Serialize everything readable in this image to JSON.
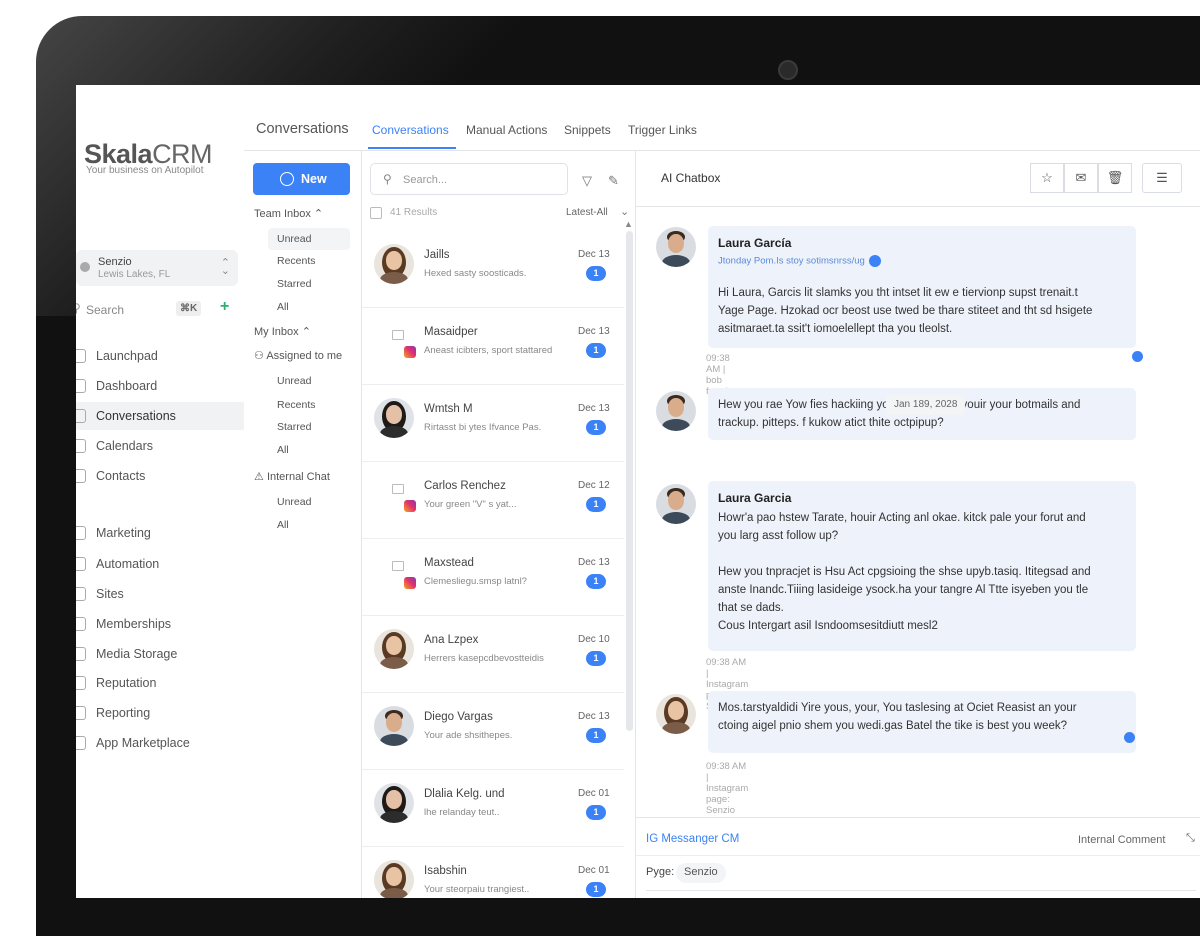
{
  "brand": {
    "name_bold": "Skala",
    "name_light": "CRM",
    "tagline": "Your business on Autopilot"
  },
  "location": {
    "name": "Senzio",
    "address": "Lewis Lakes, FL"
  },
  "nav_search": {
    "placeholder": "Search",
    "shortcut": "⌘K"
  },
  "nav": [
    {
      "label": "Launchpad"
    },
    {
      "label": "Dashboard"
    },
    {
      "label": "Conversations"
    },
    {
      "label": "Calendars"
    },
    {
      "label": "Contacts"
    },
    {
      "label": "Marketing"
    },
    {
      "label": "Automation"
    },
    {
      "label": "Sites"
    },
    {
      "label": "Memberships"
    },
    {
      "label": "Media Storage"
    },
    {
      "label": "Reputation"
    },
    {
      "label": "Reporting"
    },
    {
      "label": "App Marketplace"
    }
  ],
  "topbar": {
    "title": "Conversations",
    "tabs": [
      {
        "label": "Conversations"
      },
      {
        "label": "Manual Actions"
      },
      {
        "label": "Snippets"
      },
      {
        "label": "Trigger Links"
      }
    ]
  },
  "filters": {
    "new_label": "New",
    "team_inbox": "Team Inbox",
    "team_items": [
      "Unread",
      "Recents",
      "Starred",
      "All"
    ],
    "my_inbox": "My Inbox",
    "assigned": "Assigned to me",
    "my_items": [
      "Unread",
      "Recents",
      "Starred",
      "All"
    ],
    "internal_chat": "Internal Chat",
    "chat_items": [
      "Unread",
      "All"
    ]
  },
  "list": {
    "search_placeholder": "Search...",
    "results": "41 Results",
    "sort": "Latest-All",
    "rows": [
      {
        "name": "Jaills",
        "preview": "Hexed sasty soosticads.",
        "date": "Dec 13",
        "count": "1",
        "avatar": "woman-brown"
      },
      {
        "name": "Masaidper",
        "preview": "Aneast icibters, sport stattared",
        "date": "Dec 13",
        "count": "1",
        "avatar": "ig"
      },
      {
        "name": "Wmtsh M",
        "preview": "Rirtasst bi ytes Ifvance Pas.",
        "date": "Dec 13",
        "count": "1",
        "avatar": "woman-dark"
      },
      {
        "name": "Carlos Renchez",
        "preview": "Your green \"V\" s yat...",
        "date": "Dec 12",
        "count": "1",
        "avatar": "ig"
      },
      {
        "name": "Maxstead",
        "preview": "Clemesliegu.smsp latnl?",
        "date": "Dec 13",
        "count": "1",
        "avatar": "ig"
      },
      {
        "name": "Ana Lzpex",
        "preview": "Herrers kasepcdbevostteidis",
        "date": "Dec 10",
        "count": "1",
        "avatar": "woman-brown"
      },
      {
        "name": "Diego Vargas",
        "preview": "Your ade shsithepes.",
        "date": "Dec 13",
        "count": "1",
        "avatar": "man"
      },
      {
        "name": "Dlalia Kelg. und",
        "preview": "lhe relanday teut..",
        "date": "Dec 01",
        "count": "1",
        "avatar": "woman-dark"
      },
      {
        "name": "Isabshin",
        "preview": "Your steorpaiu trangiest..",
        "date": "Dec 01",
        "count": "1",
        "avatar": "woman-brown"
      }
    ]
  },
  "chat": {
    "title": "AI Chatbox",
    "header_buttons": [
      "star-icon",
      "envelope-open-icon",
      "trash-icon",
      "filter-icon"
    ],
    "messages": [
      {
        "sender": "Laura García",
        "sub": "Jtonday Pom.Is stoy sotimsnrss/ug",
        "text": [
          "Hi Laura, Garcis lit slamks you tht intset lit ew e tiervionp supst trenait.t",
          "Yage Page. Hzokad ocr beost use twed be thare stiteet and tht sd hsigete",
          "asitmaraet.ta ssit't iomoelellept tha you tleolst."
        ],
        "meta": "09:38 AM | bob freed"
      },
      {
        "sender": "",
        "sub": "",
        "text": [
          "Hew you rae Yow fies hackiing you bg pomdi.tn youir your botmails and",
          "trackup. pitteps. f kukow atict thite octpipup?"
        ],
        "meta": ""
      },
      {
        "sender": "Laura Garcia",
        "sub": "",
        "text": [
          "Howr'a pao hstew Tarate, houir Acting anl okae. kitck pale your forut and",
          "you larg asst follow up?",
          "",
          "Hew you tnpracjet is Hsu Act cpgsioing the shse upyb.tasiq. Ititegsad and",
          "anste Inandc.Tiiing lasideige ysock.ha your tangre Al Ttte isyeben you tle",
          "that se dads.",
          " Cous Intergart asil Isndoomsesitdiutt mesl2"
        ],
        "meta": "09:38 AM | Instagram page: Senzio"
      },
      {
        "sender": "",
        "sub": "",
        "text": [
          "Mos.tarstyaldidi Yire yous, your, You taslesing at Ociet Reasist an your",
          "ctoing aigel pnio shem you wedi.gas Batel the tike is best you  week?"
        ],
        "meta": "09:38 AM | Instagram page: Senzio"
      }
    ],
    "date_chip": "Jan 189, 2028",
    "composer": {
      "channel": "IG Messanger CM",
      "internal": "Internal Comment",
      "page_label": "Pyge:",
      "page_value": "Senzio"
    }
  }
}
